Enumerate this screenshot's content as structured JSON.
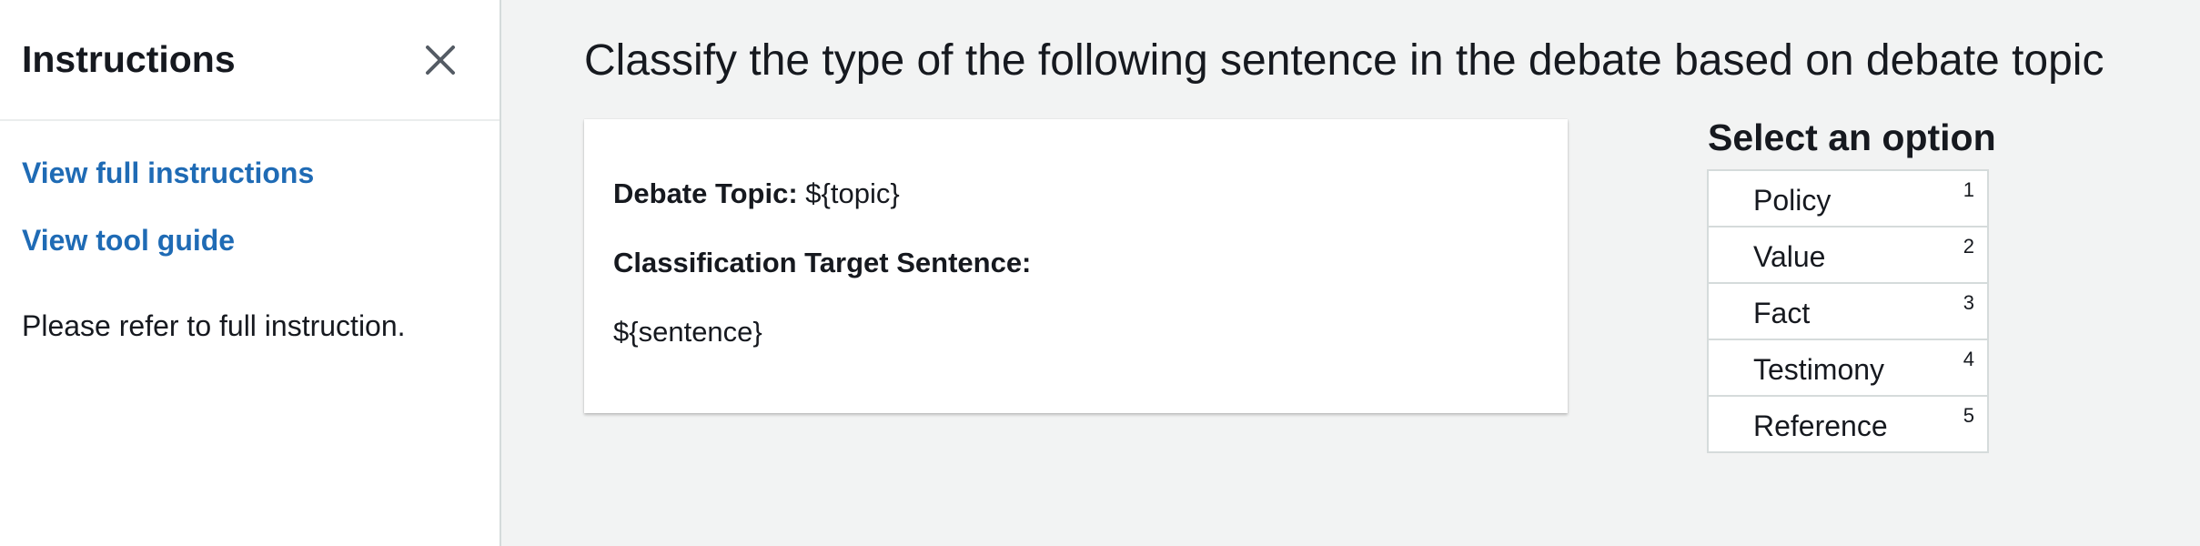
{
  "sidebar": {
    "title": "Instructions",
    "close_icon": "close-icon",
    "links": {
      "full_instructions": "View full instructions",
      "tool_guide": "View tool guide"
    },
    "note": "Please refer to full instruction."
  },
  "main": {
    "heading": "Classify the type of the following sentence in the debate based on debate topic",
    "card": {
      "topic_label": "Debate Topic:",
      "topic_value": "${topic}",
      "target_label": "Classification Target Sentence:",
      "sentence_value": "${sentence}"
    }
  },
  "options": {
    "title": "Select an option",
    "items": [
      {
        "label": "Policy",
        "key": "1"
      },
      {
        "label": "Value",
        "key": "2"
      },
      {
        "label": "Fact",
        "key": "3"
      },
      {
        "label": "Testimony",
        "key": "4"
      },
      {
        "label": "Reference",
        "key": "5"
      }
    ]
  },
  "colors": {
    "link": "#1f6bb5",
    "background": "#f2f3f3",
    "text": "#16191f",
    "border": "#d5dbdb"
  }
}
